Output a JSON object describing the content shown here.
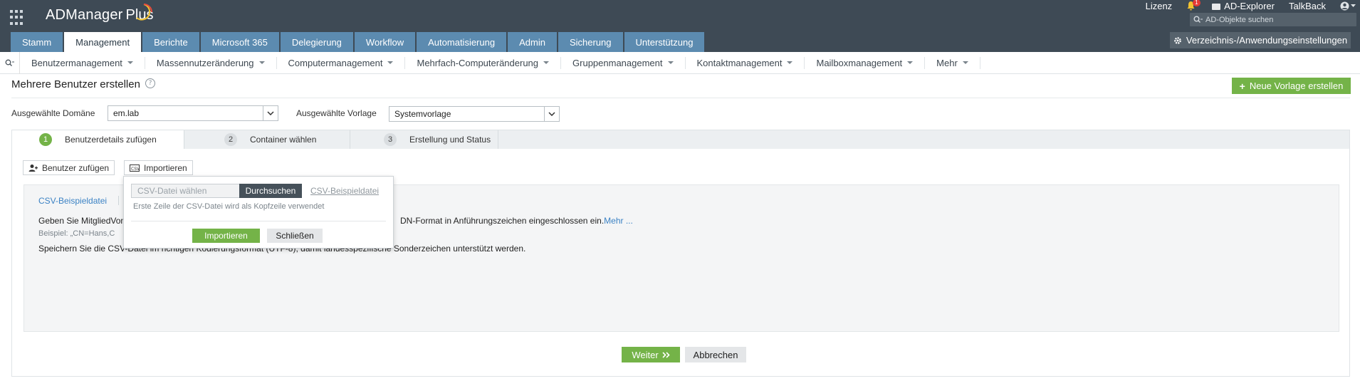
{
  "app": {
    "name": "ADManager Plus",
    "name_main": "ADManager",
    "name_plus": "Plus",
    "colors": {
      "header_bg": "#3e4a55",
      "tab_bg": "#5c8bb0",
      "accent_green": "#74b348",
      "link_blue": "#3b82c4"
    }
  },
  "top_links": {
    "license": "Lizenz",
    "notification_count": "1",
    "ad_explorer": "AD-Explorer",
    "talkback": "TalkBack"
  },
  "search": {
    "placeholder": "AD-Objekte suchen"
  },
  "tabs": [
    {
      "label": "Stamm",
      "active": false
    },
    {
      "label": "Management",
      "active": true
    },
    {
      "label": "Berichte",
      "active": false
    },
    {
      "label": "Microsoft 365",
      "active": false
    },
    {
      "label": "Delegierung",
      "active": false
    },
    {
      "label": "Workflow",
      "active": false
    },
    {
      "label": "Automatisierung",
      "active": false
    },
    {
      "label": "Admin",
      "active": false
    },
    {
      "label": "Sicherung",
      "active": false
    },
    {
      "label": "Unterstützung",
      "active": false
    }
  ],
  "settings_button": "Verzeichnis-/Anwendungseinstellungen",
  "subnav": [
    "Benutzermanagement",
    "Massennutzeränderung",
    "Computermanagement",
    "Mehrfach-Computeränderung",
    "Gruppenmanagement",
    "Kontaktmanagement",
    "Mailboxmanagement",
    "Mehr"
  ],
  "page": {
    "title": "Mehrere Benutzer erstellen",
    "help": "?",
    "new_template_button": "Neue Vorlage erstellen",
    "domain_label": "Ausgewählte Domäne",
    "domain_value": "em.lab",
    "template_label": "Ausgewählte Vorlage",
    "template_value": "Systemvorlage"
  },
  "wizard": {
    "steps": [
      {
        "num": "1",
        "label": "Benutzerdetails zufügen",
        "active": true
      },
      {
        "num": "2",
        "label": "Container wählen",
        "active": false
      },
      {
        "num": "3",
        "label": "Erstellung und Status",
        "active": false
      }
    ],
    "add_users_button": "Benutzer zufügen",
    "import_button": "Importieren",
    "csv_sample_link": "CSV-Beispieldatei",
    "info_line1_start": "Geben Sie MitgliedVon",
    "info_line1_end": "DN-Format in Anführungszeichen eingeschlossen ein.",
    "more_link": "Mehr ...",
    "example_line": "Beispiel: „CN=Hans,C",
    "encoding_line": "Speichern Sie die CSV-Datei im richtigen Kodierungsformat (UTF-8), damit landesspezifische Sonderzeichen unterstützt werden."
  },
  "import_popup": {
    "file_placeholder": "CSV-Datei wählen",
    "browse_button": "Durchsuchen",
    "csv_sample_link": "CSV-Beispieldatei",
    "hint": "Erste Zeile der CSV-Datei wird als Kopfzeile verwendet",
    "import_button": "Importieren",
    "close_button": "Schließen"
  },
  "footer": {
    "next_button": "Weiter",
    "cancel_button": "Abbrechen"
  }
}
